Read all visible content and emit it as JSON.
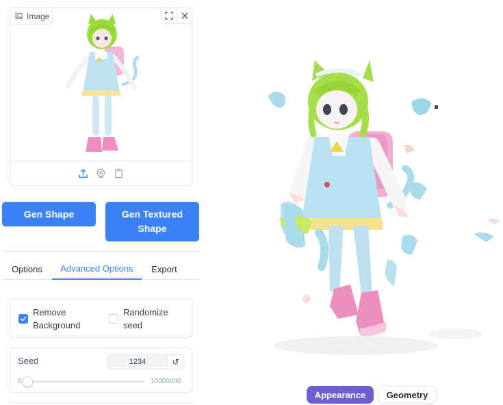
{
  "image_panel": {
    "label": "Image",
    "label_icon": "image-icon",
    "fullscreen_icon": "fullscreen-icon",
    "close_icon": "close-icon",
    "footer_icons": [
      "upload-icon",
      "webcam-icon",
      "clipboard-icon"
    ]
  },
  "buttons": {
    "gen_shape": "Gen Shape",
    "gen_textured": "Gen Textured Shape"
  },
  "tabs": [
    {
      "label": "Options",
      "selected": false
    },
    {
      "label": "Advanced Options",
      "selected": true
    },
    {
      "label": "Export",
      "selected": false
    }
  ],
  "options": {
    "remove_background": {
      "label": "Remove Background",
      "checked": true
    },
    "randomize_seed": {
      "label": "Randomize seed",
      "checked": false
    }
  },
  "seed": {
    "label": "Seed",
    "value": "1234",
    "reset_icon": "↺",
    "slider_min": "0",
    "slider_max": "10000000",
    "slider_fraction": 0.0001234
  },
  "viewer": {
    "appearance_label": "Appearance",
    "geometry_label": "Geometry",
    "active_view": "Appearance"
  },
  "colors": {
    "accent": "#3b82f6",
    "view_active": "#6b5fd3"
  }
}
